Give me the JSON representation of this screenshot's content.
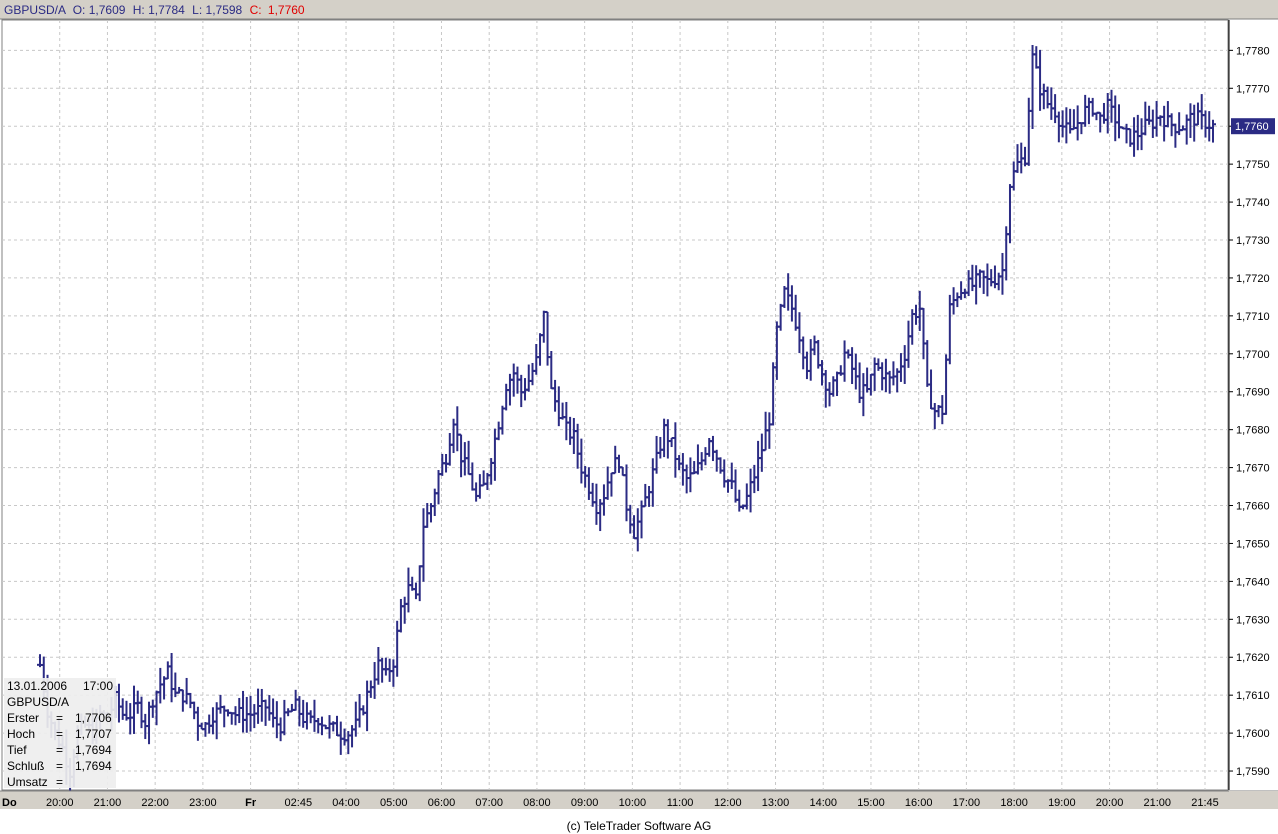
{
  "header": {
    "symbol": "GBPUSD/A",
    "open_label": "O:",
    "open": "1,7609",
    "high_label": "H:",
    "high": "1,7784",
    "low_label": "L:",
    "low": "1,7598",
    "close_label": "C:",
    "close": "1,7760"
  },
  "info_panel": {
    "date": "13.01.2006",
    "time": "17:00",
    "symbol": "GBPUSD/A",
    "rows": [
      {
        "label": "Erster",
        "value": "1,7706"
      },
      {
        "label": "Hoch",
        "value": "1,7707"
      },
      {
        "label": "Tief",
        "value": "1,7694"
      },
      {
        "label": "Schluß",
        "value": "1,7694"
      },
      {
        "label": "Umsatz",
        "value": ""
      }
    ]
  },
  "copyright": "(c) TeleTrader Software AG",
  "colors": {
    "series": "#2b2b84",
    "grid": "#c8c8c8",
    "header_bg": "#d4d0c8",
    "axis_bg": "#d4d0c8",
    "last_price_bg": "#2b2b84",
    "close_red": "#e00000"
  },
  "chart_data": {
    "type": "ohlc",
    "title": "GBPUSD/A",
    "y_ticks": [
      "1,7590",
      "1,7600",
      "1,7610",
      "1,7620",
      "1,7630",
      "1,7640",
      "1,7650",
      "1,7660",
      "1,7670",
      "1,7680",
      "1,7690",
      "1,7700",
      "1,7710",
      "1,7720",
      "1,7730",
      "1,7740",
      "1,7750",
      "1,7760",
      "1,7770",
      "1,7780"
    ],
    "ylim": [
      1.7585,
      1.7788
    ],
    "last_price_label": "1,7760",
    "x_ticks": [
      {
        "label": "Do",
        "bold": true
      },
      {
        "label": "20:00"
      },
      {
        "label": "21:00"
      },
      {
        "label": "22:00"
      },
      {
        "label": "23:00"
      },
      {
        "label": "Fr",
        "bold": true
      },
      {
        "label": "02:45"
      },
      {
        "label": "04:00"
      },
      {
        "label": "05:00"
      },
      {
        "label": "06:00"
      },
      {
        "label": "07:00"
      },
      {
        "label": "08:00"
      },
      {
        "label": "09:00"
      },
      {
        "label": "10:00"
      },
      {
        "label": "11:00"
      },
      {
        "label": "12:00"
      },
      {
        "label": "13:00"
      },
      {
        "label": "14:00"
      },
      {
        "label": "15:00"
      },
      {
        "label": "16:00"
      },
      {
        "label": "17:00"
      },
      {
        "label": "18:00"
      },
      {
        "label": "19:00"
      },
      {
        "label": "20:00"
      },
      {
        "label": "21:00"
      },
      {
        "label": "21:45"
      }
    ],
    "close_path": [
      1.7618,
      1.7606,
      1.76,
      1.7596,
      1.759,
      1.76,
      1.7602,
      1.76,
      1.7605,
      1.7604,
      1.7609,
      1.7605,
      1.7605,
      1.7607,
      1.7603,
      1.7609,
      1.7613,
      1.7616,
      1.761,
      1.761,
      1.7608,
      1.7603,
      1.7602,
      1.7605,
      1.7606,
      1.7607,
      1.7605,
      1.7605,
      1.7605,
      1.7606,
      1.7607,
      1.7603,
      1.7602,
      1.7605,
      1.7607,
      1.7604,
      1.7603,
      1.7604,
      1.7602,
      1.7601,
      1.76,
      1.76,
      1.7602,
      1.7607,
      1.7613,
      1.7618,
      1.7615,
      1.7619,
      1.7633,
      1.7638,
      1.7635,
      1.7655,
      1.766,
      1.7668,
      1.7673,
      1.7683,
      1.7673,
      1.7668,
      1.7662,
      1.7665,
      1.7673,
      1.7682,
      1.7692,
      1.7695,
      1.769,
      1.7693,
      1.7698,
      1.771,
      1.769,
      1.7685,
      1.768,
      1.7678,
      1.767,
      1.7665,
      1.766,
      1.7663,
      1.767,
      1.7672,
      1.766,
      1.7653,
      1.7658,
      1.7665,
      1.7672,
      1.768,
      1.7676,
      1.767,
      1.7667,
      1.7668,
      1.7672,
      1.7678,
      1.7673,
      1.7668,
      1.7665,
      1.7658,
      1.7662,
      1.7668,
      1.7675,
      1.7683,
      1.7706,
      1.7716,
      1.7712,
      1.7705,
      1.7697,
      1.7702,
      1.7695,
      1.769,
      1.7693,
      1.77,
      1.7696,
      1.769,
      1.769,
      1.7697,
      1.7695,
      1.7693,
      1.7695,
      1.77,
      1.771,
      1.7712,
      1.769,
      1.7685,
      1.7685,
      1.7712,
      1.7716,
      1.7718,
      1.7718,
      1.772,
      1.7719,
      1.772,
      1.7722,
      1.7745,
      1.775,
      1.7752,
      1.7778,
      1.777,
      1.7766,
      1.7764,
      1.776,
      1.7758,
      1.7761,
      1.7764,
      1.7765,
      1.7762,
      1.7765,
      1.7762,
      1.7758,
      1.7757,
      1.7758,
      1.776,
      1.7761,
      1.7763,
      1.7761,
      1.776,
      1.776,
      1.7762,
      1.7762,
      1.7761,
      1.776
    ]
  }
}
